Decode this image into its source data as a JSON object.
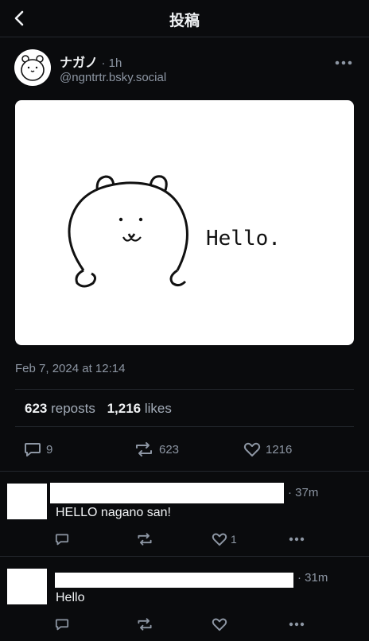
{
  "header": {
    "title": "投稿"
  },
  "post": {
    "author_name": "ナガノ",
    "time": "· 1h",
    "handle": "@ngntrtr.bsky.social",
    "image_text": "Hello.",
    "date": "Feb 7, 2024 at 12:14",
    "stats": {
      "reposts_count": "623",
      "reposts_label": "reposts",
      "likes_count": "1,216",
      "likes_label": "likes"
    },
    "actions": {
      "replies": "9",
      "reposts": "623",
      "likes": "1216"
    }
  },
  "replies": [
    {
      "time": "· 37m",
      "text": "HELLO nagano san!",
      "likes": "1"
    },
    {
      "time": "· 31m",
      "text": "Hello",
      "likes": ""
    }
  ],
  "colors": {
    "background": "#0a0b0d",
    "muted": "#8d96a3",
    "divider": "#24282e"
  }
}
